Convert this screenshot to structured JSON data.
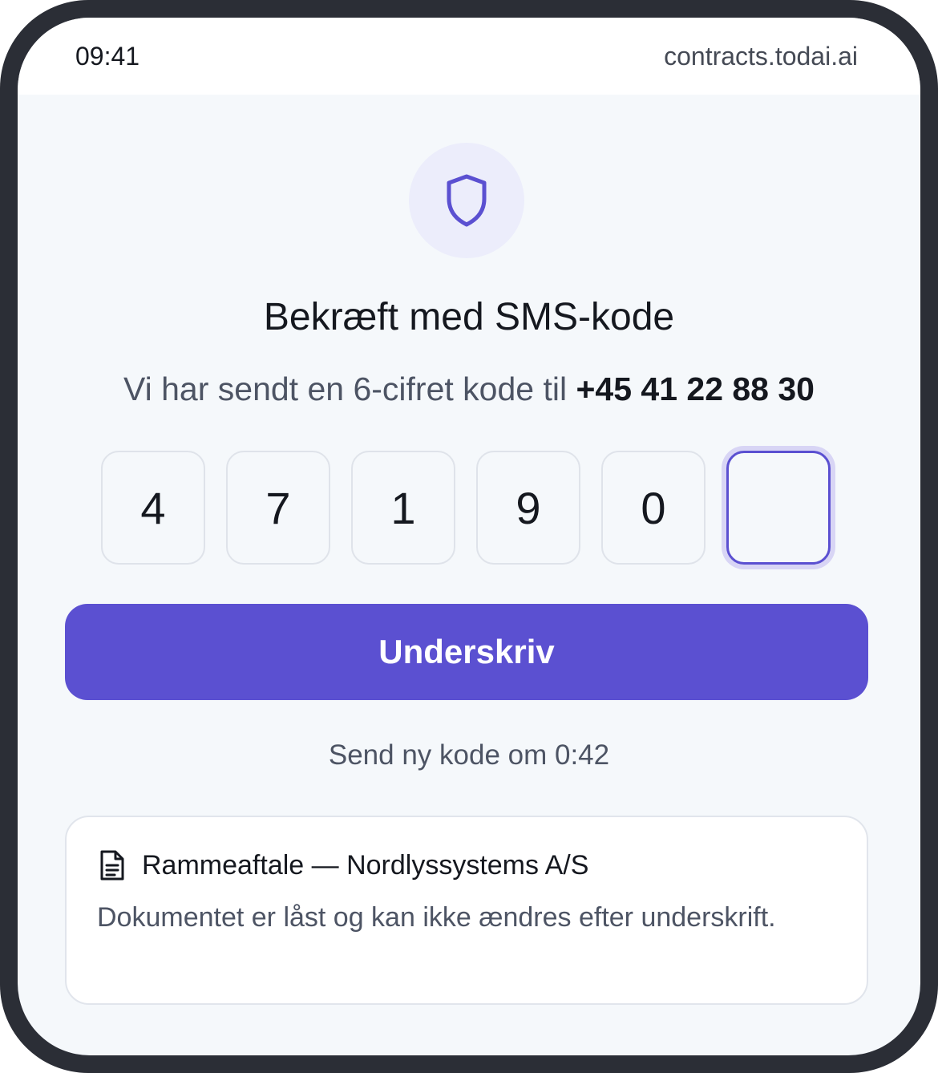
{
  "status_bar": {
    "time": "09:41",
    "url": "contracts.todai.ai"
  },
  "header": {
    "icon": "shield-icon",
    "title": "Bekræft med SMS-kode",
    "subtitle_prefix": "Vi har sendt en 6-cifret kode til ",
    "phone": "+45 41 22 88 30"
  },
  "code": {
    "digits": [
      "4",
      "7",
      "1",
      "9",
      "0",
      ""
    ]
  },
  "actions": {
    "sign_label": "Underskriv",
    "resend_text": "Send ny kode om 0:42"
  },
  "document": {
    "icon": "document-icon",
    "title": "Rammeaftale — Nordlyssystems A/S",
    "description": "Dokumentet er låst og kan ikke ændres efter underskrift."
  },
  "colors": {
    "accent": "#5b50d1",
    "accent_soft": "#ecedfb",
    "text": "#15181f",
    "muted": "#4d5464"
  }
}
